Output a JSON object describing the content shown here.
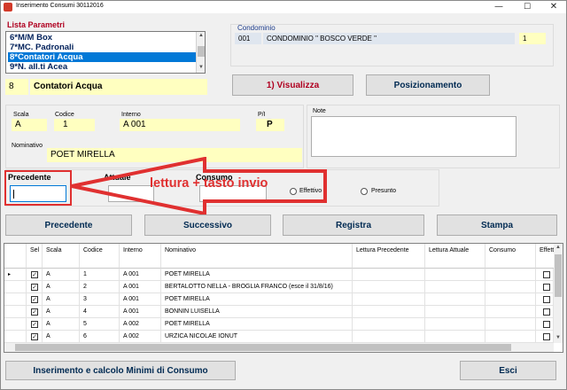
{
  "window": {
    "title": "Inserimento Consumi 30112016",
    "min_glyph": "—",
    "max_glyph": "☐",
    "close_glyph": "✕"
  },
  "lista": {
    "label": "Lista Parametri",
    "items": [
      "6*M/M Box",
      "7*MC. Padronali",
      "8*Contatori Acqua",
      "9*N. all.ti Acea"
    ],
    "selected_code": "8",
    "selected_name": "Contatori Acqua",
    "scroll_up": "▲",
    "scroll_down": "▼"
  },
  "condominio": {
    "label": "Condominio",
    "code": "001",
    "name": "CONDOMINIO \" BOSCO VERDE \"",
    "number": "1"
  },
  "buttons": {
    "visualizza": "1) Visualizza",
    "posizionamento": "Posizionamento",
    "precedente": "Precedente",
    "successivo": "Successivo",
    "registra": "Registra",
    "stampa": "Stampa",
    "inserimento": "Inserimento e calcolo Minimi di Consumo",
    "esci": "Esci"
  },
  "record": {
    "scala_label": "Scala",
    "scala": "A",
    "codice_label": "Codice",
    "codice": "1",
    "interno_label": "Interno",
    "interno": "A 001",
    "pi_label": "P/I",
    "pi": "P",
    "note_label": "Note",
    "nominativo_label": "Nominativo",
    "nominativo": "POET MIRELLA"
  },
  "lettura": {
    "precedente_label": "Precedente",
    "attuale_label": "Attuale",
    "consumo_label": "Consumo",
    "precedente_value": "",
    "radio_effettivo": "Effettivo",
    "radio_presunto": "Presunto"
  },
  "annotation": {
    "text": "lettura + tasto invio",
    "color": "#e03030"
  },
  "grid": {
    "headers": [
      "Sel",
      "Scala",
      "Codice",
      "Interno",
      "Nominativo",
      "Lettura Precedente",
      "Lettura Attuale",
      "Consumo",
      "Effetti"
    ],
    "row_marker": "▸",
    "check_glyph": "✓",
    "rows": [
      {
        "sel": true,
        "scala": "A",
        "codice": "1",
        "interno": "A 001",
        "nominativo": "POET MIRELLA",
        "lett_prec": "",
        "lett_att": "",
        "consumo": ""
      },
      {
        "sel": true,
        "scala": "A",
        "codice": "2",
        "interno": "A 001",
        "nominativo": "BERTALOTTO NELLA - BROGLIA FRANCO (esce il 31/8/16)",
        "lett_prec": "",
        "lett_att": "",
        "consumo": ""
      },
      {
        "sel": true,
        "scala": "A",
        "codice": "3",
        "interno": "A 001",
        "nominativo": "POET MIRELLA",
        "lett_prec": "",
        "lett_att": "",
        "consumo": ""
      },
      {
        "sel": true,
        "scala": "A",
        "codice": "4",
        "interno": "A 001",
        "nominativo": "BONNIN LUISELLA",
        "lett_prec": "",
        "lett_att": "",
        "consumo": ""
      },
      {
        "sel": true,
        "scala": "A",
        "codice": "5",
        "interno": "A 002",
        "nominativo": "POET MIRELLA",
        "lett_prec": "",
        "lett_att": "",
        "consumo": ""
      },
      {
        "sel": true,
        "scala": "A",
        "codice": "6",
        "interno": "A 002",
        "nominativo": "URZICA NICOLAE IONUT",
        "lett_prec": "",
        "lett_att": "",
        "consumo": ""
      }
    ]
  }
}
